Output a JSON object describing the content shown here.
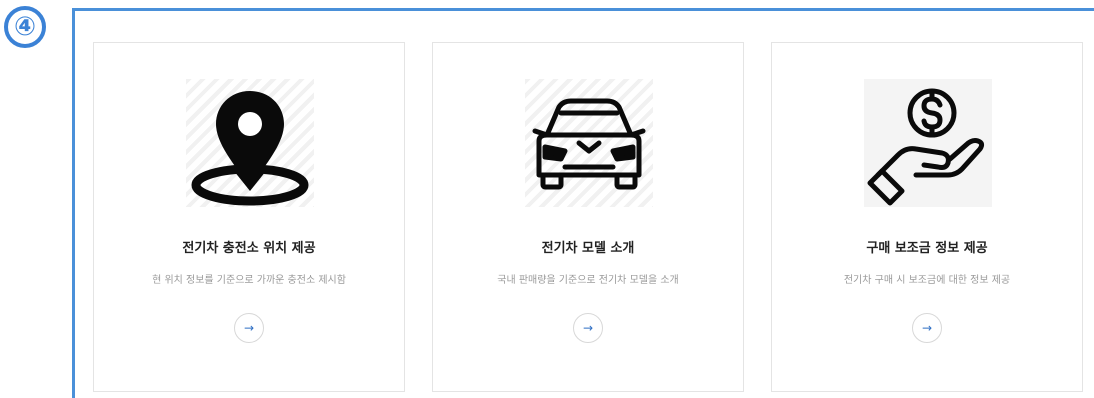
{
  "step_badge": "④",
  "cards": [
    {
      "icon": "map-pin-icon",
      "title": "전기차 충전소 위치 제공",
      "description": "현 위치 정보를 기준으로 가까운 충전소 제시함",
      "arrow": "→"
    },
    {
      "icon": "car-icon",
      "title": "전기차 모델 소개",
      "description": "국내 판매량을 기준으로 전기차 모델을 소개",
      "arrow": "→"
    },
    {
      "icon": "money-hand-icon",
      "title": "구매 보조금 정보 제공",
      "description": "전기차 구매 시 보조금에 대한 정보 제공",
      "arrow": "→"
    }
  ],
  "colors": {
    "accent": "#4a90d9",
    "badge": "#3b82d6",
    "arrow": "#2f6fc4"
  }
}
